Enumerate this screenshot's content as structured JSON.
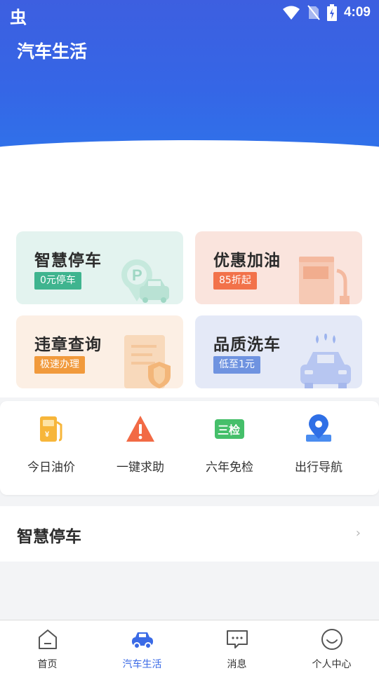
{
  "status": {
    "app_glyph": "虫",
    "time": "4:09"
  },
  "header": {
    "title": "汽车生活"
  },
  "cards": [
    {
      "title": "智慧停车",
      "tag": "0元停车",
      "tag_color": "#3fb48f",
      "icon": "parking-car-icon"
    },
    {
      "title": "优惠加油",
      "tag": "85折起",
      "tag_color": "#f2724a",
      "icon": "gas-station-icon"
    },
    {
      "title": "违章查询",
      "tag": "极速办理",
      "tag_color": "#f19a3c",
      "icon": "document-shield-icon"
    },
    {
      "title": "品质洗车",
      "tag": "低至1元",
      "tag_color": "#6f93e0",
      "icon": "car-wash-icon"
    }
  ],
  "quick": [
    {
      "label": "今日油价",
      "icon": "fuel-price-icon"
    },
    {
      "label": "一键求助",
      "icon": "warning-icon"
    },
    {
      "label": "六年免检",
      "icon": "inspection-icon"
    },
    {
      "label": "出行导航",
      "icon": "navigation-icon"
    }
  ],
  "section": {
    "title": "智慧停车",
    "arrow": "›"
  },
  "nav": [
    {
      "label": "首页",
      "icon": "home-icon"
    },
    {
      "label": "汽车生活",
      "icon": "car-icon"
    },
    {
      "label": "消息",
      "icon": "message-icon"
    },
    {
      "label": "个人中心",
      "icon": "profile-icon"
    }
  ],
  "colors": {
    "primary": "#3a6ae6",
    "bg": "#f3f4f6"
  }
}
